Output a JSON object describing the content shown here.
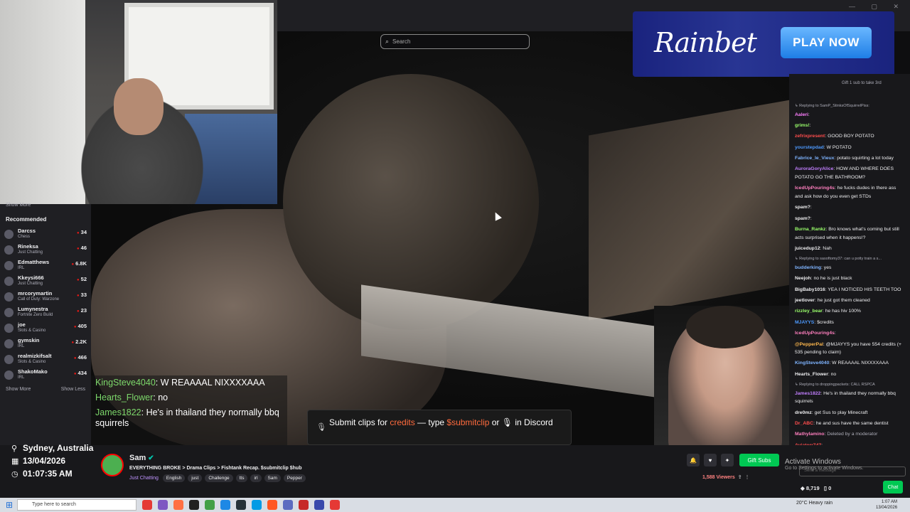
{
  "search": {
    "placeholder": "Search"
  },
  "ad": {
    "brand": "Rainbet",
    "cta": "PLAY NOW"
  },
  "sidebar": {
    "show_more_top": "Show More",
    "recommended_title": "Recommended",
    "items": [
      {
        "name": "Darcss",
        "game": "Chess",
        "viewers": "34"
      },
      {
        "name": "Rineksa",
        "game": "Just Chatting",
        "viewers": "46"
      },
      {
        "name": "Edmatthews",
        "game": "IRL",
        "viewers": "6.8K"
      },
      {
        "name": "Kkeysi666",
        "game": "Just Chatting",
        "viewers": "52"
      },
      {
        "name": "mrcorymartin",
        "game": "Call of Duty: Warzone",
        "viewers": "33"
      },
      {
        "name": "Lumynestra",
        "game": "Fortnite Zero Build",
        "viewers": "23"
      },
      {
        "name": "joe",
        "game": "Slots & Casino",
        "viewers": "405"
      },
      {
        "name": "gymskin",
        "game": "IRL",
        "viewers": "2.2K"
      },
      {
        "name": "realmizkifsalt",
        "game": "Slots & Casino",
        "viewers": "466"
      },
      {
        "name": "ShakoMako",
        "game": "IRL",
        "viewers": "434"
      }
    ],
    "show_more": "Show More",
    "show_less": "Show Less"
  },
  "overlay_chat": [
    {
      "user": "KingSteve4040",
      "text": ": W REAAAAL NIXXXXAAA"
    },
    {
      "user": "Hearts_Flower",
      "text": ": no"
    },
    {
      "user": "James1822",
      "text": ": He's in thailand they normally bbq squirrels"
    }
  ],
  "banner": {
    "pre": "Submit clips for ",
    "hl1": "credits",
    "mid": " — type ",
    "hl2": "$submitclip",
    "post": " or",
    "post2": " in Discord"
  },
  "chat_header": {
    "gift_text": "Gift 1 sub to take 3rd"
  },
  "chat": [
    {
      "reply": "Replying to SamP_StinksOfSquirrelPiss: "
    },
    {
      "user": "Aaleri",
      "color": "#ff7fff",
      "text": ":"
    },
    {
      "user": "grims!",
      "color": "#9aff6b",
      "text": ":"
    },
    {
      "user": "zefrixpresent",
      "color": "#ff4d4d",
      "text": ": GOOD BOY POTATO"
    },
    {
      "user": "yourstepdad",
      "color": "#4d9aff",
      "text": ": W POTATO"
    },
    {
      "user": "Fabrice_le_Vieux",
      "color": "#7fb4ff",
      "text": ": potato squirting a lot today"
    },
    {
      "user": "AuroraGoryAlice",
      "color": "#c27fff",
      "text": ": HOW AND WHERE DOES POTATO GO THE BATHROOM?"
    },
    {
      "user": "IcedUpPouring4s",
      "color": "#ff7fbf",
      "text": ": he fucks dudes in there ass and ask how do you even get STDs"
    },
    {
      "user": "spam?",
      "color": "#efeff1",
      "text": ":"
    },
    {
      "user": "spam?",
      "color": "#efeff1",
      "text": ":"
    },
    {
      "user": "Burna_Rankz",
      "color": "#9aff6b",
      "text": ": Bro knows what's coming but still acts surprised when it happens!?"
    },
    {
      "user": "juicedup12",
      "color": "#efeff1",
      "text": ": Nah"
    },
    {
      "reply": "Replying to sasoftomy37: can u potty train a s..."
    },
    {
      "user": "budderking",
      "color": "#7fb4ff",
      "text": ": yes"
    },
    {
      "user": "Neejoh",
      "color": "#efeff1",
      "text": ": no he is just black"
    },
    {
      "user": "BigBaby1016",
      "color": "#efeff1",
      "text": ": YEA I NOTICED HIS TEETH TOO"
    },
    {
      "user": "jeetlover",
      "color": "#efeff1",
      "text": ": he just got them cleaned"
    },
    {
      "user": "rizzley_bear",
      "color": "#9aff6b",
      "text": ": he has hiv 100%"
    },
    {
      "user": "MJAYYS",
      "color": "#4d9aff",
      "text": ": $credits"
    },
    {
      "user": "IcedUpPouring4s",
      "color": "#ff7fbf",
      "text": ":"
    },
    {
      "user": "@PepperPal",
      "color": "#ffb84d",
      "text": ": @MJAYYS you have 554 credits (+ 535 pending to claim)"
    },
    {
      "user": "KingSteve4040",
      "color": "#7fb4ff",
      "text": ": W REAAAAL NIXXXXAAA"
    },
    {
      "user": "Hearts_Flower",
      "color": "#efeff1",
      "text": ": no"
    },
    {
      "reply": "Replying to droppingpackets: CALL RSPCA"
    },
    {
      "user": "James1822",
      "color": "#c27fff",
      "text": ": He's in thailand they normally bbq squirrels"
    },
    {
      "user": "dre0mz",
      "color": "#efeff1",
      "text": ": get Sus to play Minecraft"
    },
    {
      "user": "Dr_ABC",
      "color": "#ff4d4d",
      "text": ": he and sus have the same dentist"
    },
    {
      "user": "Mathylamino",
      "color": "#ff7fbf",
      "text": ": ",
      "deleted": "Deleted by a moderator"
    },
    {
      "user": "Aviatorr747",
      "color": "#ff4d4d",
      "text": ":"
    }
  ],
  "location": {
    "place": "Sydney, Australia",
    "date": "13/04/2026",
    "time": "01:07:35 AM"
  },
  "streamer": {
    "name": "Sam",
    "title": "EVERYTHING BROKE > Drama Clips > Fishtank Recap. $submitclip $hub",
    "category": "Just Chatting",
    "tags": [
      "English",
      "just",
      "Challenge",
      "tts",
      "irl",
      "Sam",
      "Pepper"
    ],
    "gift_subs": "Gift Subs",
    "viewers": "1,588 Viewers"
  },
  "chat_footer": {
    "points": "8,719",
    "zero": "0",
    "chat_button": "Chat",
    "send_placeholder": "Send a message"
  },
  "activate": {
    "title": "Activate Windows",
    "sub": "Go to Settings to activate Windows."
  },
  "taskbar": {
    "search": "Type here to search",
    "weather": "20°C  Heavy rain",
    "time": "1:07 AM",
    "date": "13/04/2026"
  }
}
